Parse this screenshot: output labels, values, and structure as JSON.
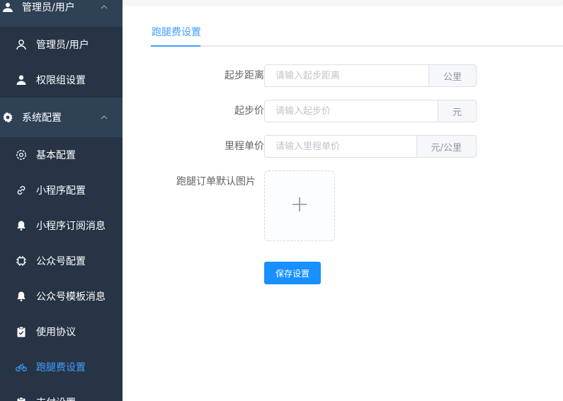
{
  "sidebar": {
    "groups": [
      {
        "label": "管理员/用户"
      },
      {
        "label": "系统配置"
      }
    ],
    "items": [
      {
        "label": "管理员/用户"
      },
      {
        "label": "权限组设置"
      },
      {
        "label": "基本配置"
      },
      {
        "label": "小程序配置"
      },
      {
        "label": "小程序订阅消息"
      },
      {
        "label": "公众号配置"
      },
      {
        "label": "公众号模板消息"
      },
      {
        "label": "使用协议"
      },
      {
        "label": "跑腿费设置"
      },
      {
        "label": "支付设置"
      }
    ],
    "active_color": "#409eff",
    "background": "#263445"
  },
  "tabs": [
    {
      "label": "跑腿费设置"
    }
  ],
  "form": {
    "start_distance": {
      "label": "起步距离",
      "placeholder": "请输入起步距离",
      "unit": "公里"
    },
    "start_price": {
      "label": "起步价",
      "placeholder": "请输入起步价",
      "unit": "元"
    },
    "unit_price": {
      "label": "里程单价",
      "placeholder": "请输入里程单价",
      "unit": "元/公里"
    },
    "default_image": {
      "label": "跑腿订单默认图片"
    },
    "save_label": "保存设置"
  }
}
